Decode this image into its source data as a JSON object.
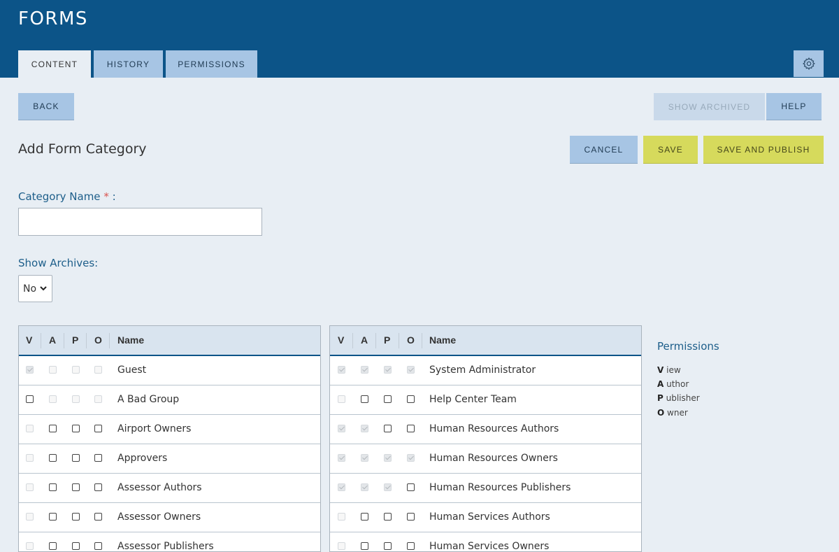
{
  "header": {
    "title": "FORMS",
    "tabs": [
      {
        "label": "CONTENT",
        "active": true
      },
      {
        "label": "HISTORY",
        "active": false
      },
      {
        "label": "PERMISSIONS",
        "active": false
      }
    ],
    "settings_icon": "gear-icon"
  },
  "toolbar": {
    "back_label": "BACK",
    "show_archived_label": "SHOW ARCHIVED",
    "help_label": "HELP"
  },
  "form": {
    "title": "Add Form Category",
    "cancel_label": "CANCEL",
    "save_label": "SAVE",
    "save_publish_label": "SAVE AND PUBLISH",
    "category_name_label": "Category Name",
    "required_mark": "*",
    "colon": " :",
    "category_name_value": "",
    "show_archives_label": "Show Archives:",
    "show_archives_value": "No"
  },
  "table": {
    "headers": {
      "v": "V",
      "a": "A",
      "p": "P",
      "o": "O",
      "name": "Name"
    },
    "left_rows": [
      {
        "name": "Guest"
      },
      {
        "name": "A Bad Group"
      },
      {
        "name": "Airport Owners"
      },
      {
        "name": "Approvers"
      },
      {
        "name": "Assessor Authors"
      },
      {
        "name": "Assessor Owners"
      },
      {
        "name": "Assessor Publishers"
      }
    ],
    "right_rows": [
      {
        "name": "System Administrator"
      },
      {
        "name": "Help Center Team"
      },
      {
        "name": "Human Resources Authors"
      },
      {
        "name": "Human Resources Owners"
      },
      {
        "name": "Human Resources Publishers"
      },
      {
        "name": "Human Services Authors"
      },
      {
        "name": "Human Services Owners"
      }
    ]
  },
  "legend": {
    "title": "Permissions",
    "items": [
      {
        "letter": "V",
        "rest": "iew"
      },
      {
        "letter": "A",
        "rest": "uthor"
      },
      {
        "letter": "P",
        "rest": "ublisher"
      },
      {
        "letter": "O",
        "rest": "wner"
      }
    ]
  }
}
